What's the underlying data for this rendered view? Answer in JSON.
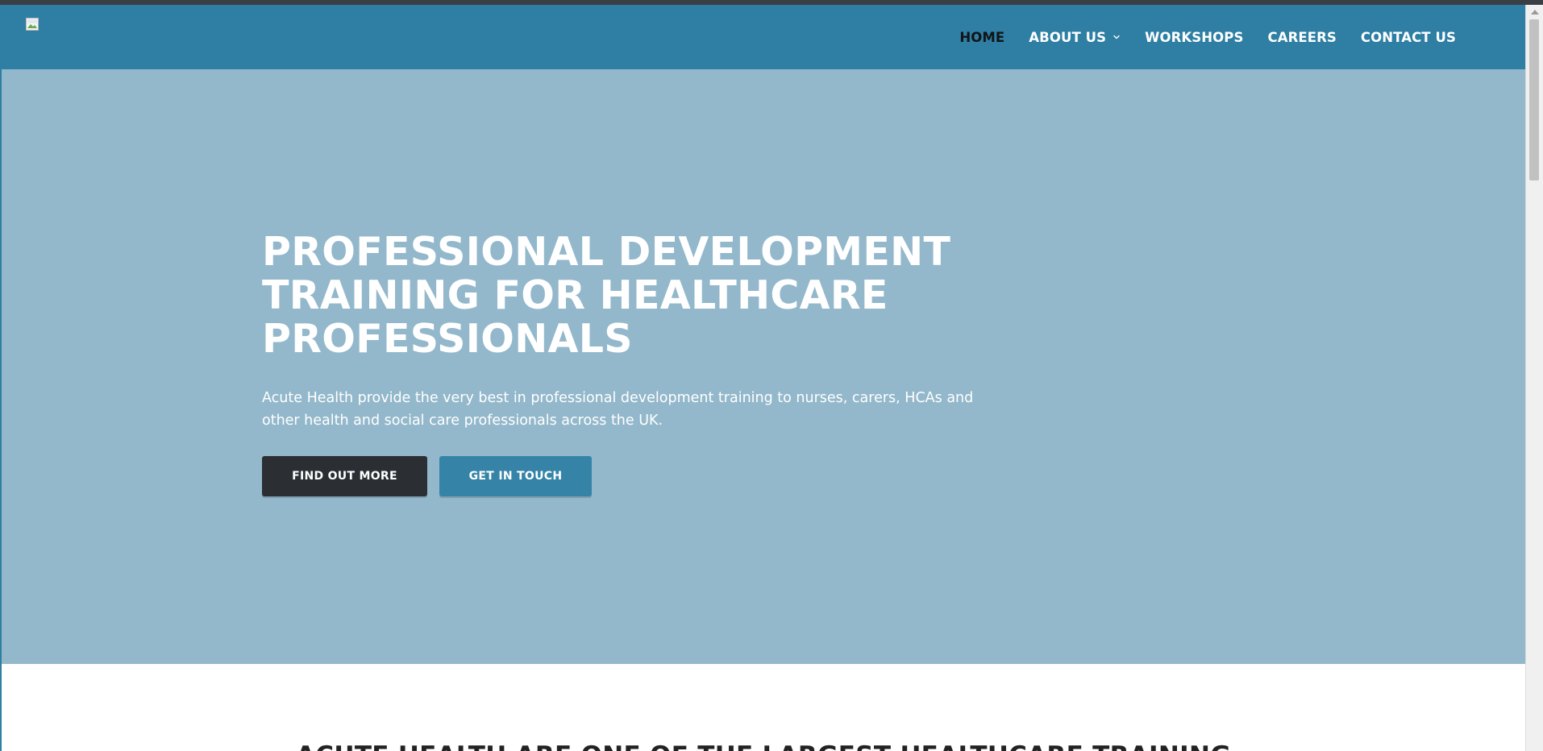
{
  "nav": {
    "items": [
      {
        "label": "HOME",
        "active": true
      },
      {
        "label": "ABOUT US",
        "has_dropdown": true
      },
      {
        "label": "WORKSHOPS"
      },
      {
        "label": "CAREERS"
      },
      {
        "label": "CONTACT US"
      }
    ],
    "dropdown_icon": "chevron-down-icon",
    "active_color": "#111418"
  },
  "logo": {
    "icon": "broken-image-icon"
  },
  "hero": {
    "title": "PROFESSIONAL DEVELOPMENT TRAINING FOR HEALTHCARE PROFESSIONALS",
    "description": "Acute Health provide the very best in professional development training to nurses, carers, HCAs and other health and social care professionals across the UK.",
    "primary_button": "FIND OUT MORE",
    "secondary_button": "GET IN TOUCH"
  },
  "section": {
    "heading": "ACUTE HEALTH ARE ONE OF THE LARGEST HEALTHCARE TRAINING"
  },
  "colors": {
    "header_bg": "#2e7fa3",
    "hero_bg": "#93b8cb",
    "dark_button": "#2b2f33",
    "blue_button": "#3584a8"
  }
}
